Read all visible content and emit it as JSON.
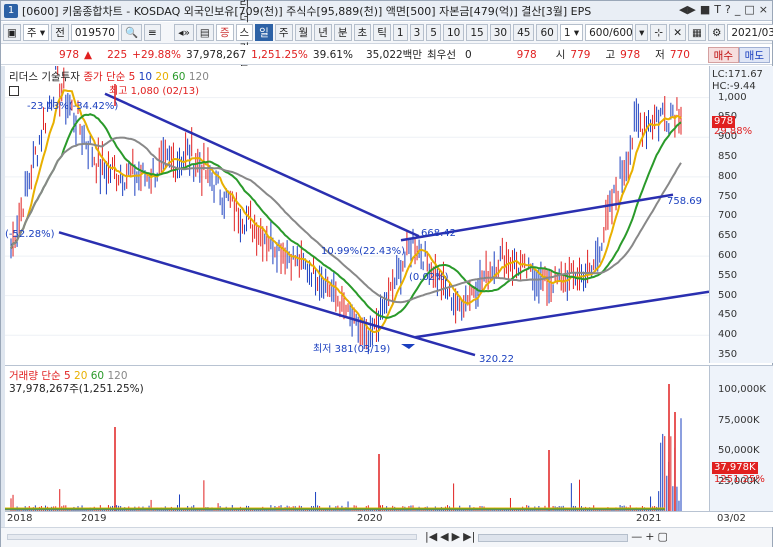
{
  "titlebar": {
    "badge": "1",
    "text": "[0600] 키움종합차트 - KOSDAQ 외국인보유[709(천)] 주식수[95,889(천)] 액면[500] 자본금[479(억)] 결산[3월] EPS",
    "controls": [
      "◀▶",
      "■",
      "T",
      "?",
      "_",
      "□",
      "×"
    ]
  },
  "toolbar": {
    "market": "주",
    "prev": "전",
    "code": "019570",
    "company_flag": "증",
    "company": "리더스 기술",
    "periods": [
      "일",
      "주",
      "월",
      "년",
      "분",
      "초",
      "틱"
    ],
    "active_period": "일",
    "intervals": [
      "1",
      "3",
      "5",
      "10",
      "15",
      "30",
      "45",
      "60"
    ],
    "count_select": "1",
    "count_display": "600/600",
    "date": "2021/03/02"
  },
  "pricebar": {
    "price": "978",
    "change": "225",
    "change_pct": "+29.88%",
    "volume": "37,978,267",
    "vol_ratio": "1,251.25%",
    "turnover": "39.61%",
    "amount": "35,022백만",
    "ref_label": "최우선",
    "ref_value": "0",
    "last": "978",
    "open_label": "시",
    "open": "779",
    "high_label": "고",
    "high": "978",
    "low_label": "저",
    "low": "770",
    "buy": "매수",
    "sell": "매도"
  },
  "price_panel": {
    "legend_name": "리더스 기술투자",
    "legend_ma_label": "종가 단순",
    "legend_ma": [
      "5",
      "10",
      "20",
      "60",
      "120"
    ],
    "legend_ma_colors": [
      "#e02020",
      "#1a3fbf",
      "#e8b000",
      "#2a9a2a",
      "#888888"
    ],
    "high_anno": "최고 1,080 (02/13)",
    "low_anno": "최저 381(03/19)",
    "left_anno": "-23.03%(-34.42%)",
    "left_edge_anno": "(-52.28%)",
    "mid_anno": "10.99%(22.43%)",
    "mid_anno2": "(0.02%)",
    "channel_labels": [
      "668.42",
      "758.69",
      "320.22"
    ],
    "lc": "LC:171.67",
    "hc": "HC:-9.44",
    "y_ticks": [
      "1,000",
      "950",
      "900",
      "850",
      "800",
      "750",
      "700",
      "650",
      "600",
      "550",
      "500",
      "450",
      "400",
      "350"
    ],
    "price_tag": "978",
    "pct_tag": "29.88%"
  },
  "volume_panel": {
    "legend_name": "거래량",
    "legend_ma_label": "단순",
    "legend_ma": [
      "5",
      "20",
      "60",
      "120"
    ],
    "legend_ma_colors": [
      "#e02020",
      "#e8b000",
      "#2a9a2a",
      "#888888"
    ],
    "current": "37,978,267주(1,251.25%)",
    "y_ticks": [
      "100,000K",
      "75,000K",
      "50,000K",
      "25,000K"
    ],
    "vol_tag": "37,978K",
    "vol_pct_tag": "1251.25%"
  },
  "x_axis": {
    "labels": [
      "2018",
      "2019",
      "2020",
      "2021"
    ],
    "right_date": "03/02"
  },
  "chart_data": {
    "type": "line",
    "title": "리더스 기술투자",
    "x": [
      "2018-12",
      "2019-02",
      "2019-04",
      "2019-06",
      "2019-08",
      "2019-10",
      "2019-12",
      "2020-02",
      "2020-03",
      "2020-05",
      "2020-07",
      "2020-09",
      "2020-11",
      "2021-01",
      "2021-02",
      "2021-03"
    ],
    "series": [
      {
        "name": "종가",
        "values": [
          620,
          1050,
          820,
          800,
          860,
          720,
          620,
          540,
          381,
          640,
          470,
          600,
          530,
          560,
          930,
          978
        ]
      }
    ],
    "ylim": [
      330,
      1080
    ],
    "volume_ylim": [
      0,
      120000000
    ]
  }
}
